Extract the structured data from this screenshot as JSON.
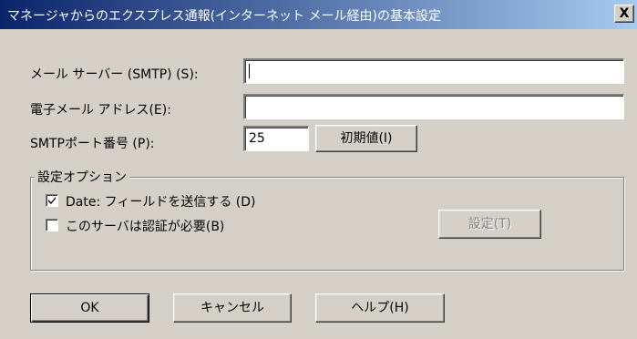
{
  "window": {
    "title": "マネージャからのエクスプレス通報(インターネット メール経由)の基本設定",
    "close_glyph": "X"
  },
  "fields": {
    "mail_server_label": "メール サーバー (SMTP) (S):",
    "mail_server_value": "",
    "email_address_label": "電子メール アドレス(E):",
    "email_address_value": "",
    "smtp_port_label": "SMTPポート番号 (P):",
    "smtp_port_value": "25",
    "default_button": "初期値(I)"
  },
  "options_group": {
    "title": "設定オプション",
    "date_field_label": "Date: フィールドを送信する (D)",
    "date_field_checked": true,
    "auth_label": "このサーバは認証が必要(B)",
    "auth_checked": false,
    "settings_button": "設定(T)"
  },
  "footer": {
    "ok": "OK",
    "cancel": "キャンセル",
    "help": "ヘルプ(H)"
  }
}
